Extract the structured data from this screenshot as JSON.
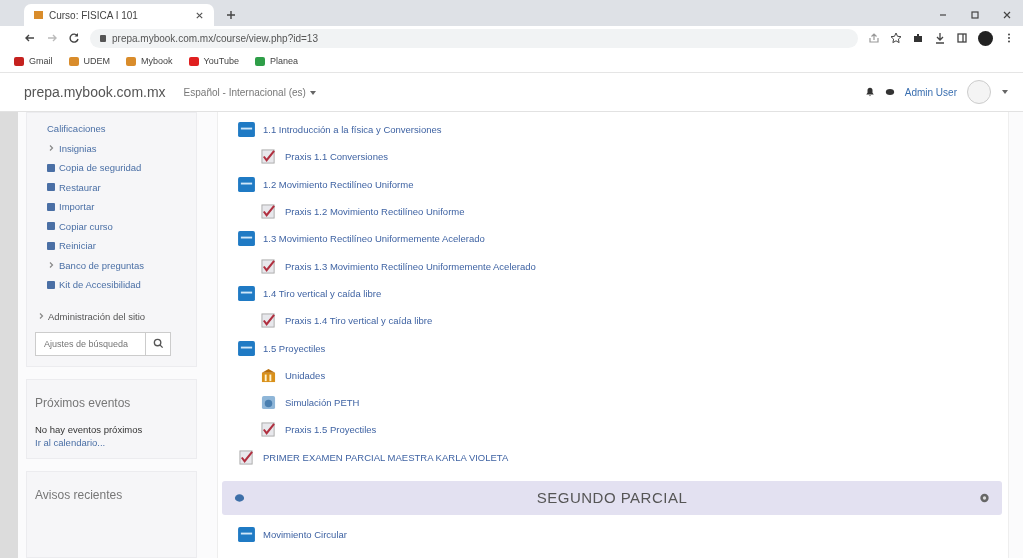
{
  "browser": {
    "tab_title": "Curso: FISICA I 101",
    "url": "prepa.mybook.com.mx/course/view.php?id=13",
    "bookmarks": [
      {
        "label": "Gmail",
        "color": "#c5221f"
      },
      {
        "label": "UDEM",
        "color": "#d98c2b"
      },
      {
        "label": "Mybook",
        "color": "#d98c2b"
      },
      {
        "label": "YouTube",
        "color": "#e02020"
      },
      {
        "label": "Planea",
        "color": "#2e9e48"
      }
    ]
  },
  "header": {
    "site": "prepa.mybook.com.mx",
    "language": "Español - Internacional (es)",
    "user": "Admin User"
  },
  "sidebar": {
    "items": [
      {
        "label": "Calificaciones",
        "kind": "plain"
      },
      {
        "label": "Insignias",
        "kind": "arrow"
      },
      {
        "label": "Copia de seguridad",
        "kind": "icon"
      },
      {
        "label": "Restaurar",
        "kind": "icon"
      },
      {
        "label": "Importar",
        "kind": "icon"
      },
      {
        "label": "Copiar curso",
        "kind": "icon"
      },
      {
        "label": "Reiniciar",
        "kind": "icon"
      },
      {
        "label": "Banco de preguntas",
        "kind": "arrow"
      },
      {
        "label": "Kit de Accesibilidad",
        "kind": "icon"
      }
    ],
    "admin": "Administración del sitio",
    "search_placeholder": "Ajustes de búsqueda",
    "events": {
      "title": "Próximos eventos",
      "text": "No hay eventos próximos",
      "link": "Ir al calendario..."
    },
    "news": {
      "title": "Avisos recientes"
    }
  },
  "content": {
    "items": [
      {
        "label": "1.1 Introducción a la física y Conversiones",
        "kind": "page",
        "children": [
          {
            "label": "Praxis 1.1 Conversiones",
            "kind": "quiz"
          }
        ]
      },
      {
        "label": "1.2 Movimiento Rectilíneo Uniforme",
        "kind": "page",
        "children": [
          {
            "label": "Praxis 1.2 Movimiento Rectilíneo Uniforme",
            "kind": "quiz"
          }
        ]
      },
      {
        "label": "1.3 Movimiento Rectilíneo Uniformemente Acelerado",
        "kind": "page",
        "children": [
          {
            "label": "Praxis 1.3 Movimiento Rectilíneo Uniformemente Acelerado",
            "kind": "quiz"
          }
        ]
      },
      {
        "label": "1.4 Tiro vertical y caída libre",
        "kind": "page",
        "children": [
          {
            "label": "Praxis 1.4 Tiro vertical y caída libre",
            "kind": "quiz"
          }
        ]
      },
      {
        "label": "1.5 Proyectiles",
        "kind": "page",
        "children": [
          {
            "label": "Unidades",
            "kind": "folder"
          },
          {
            "label": "Simulación PETH",
            "kind": "simulation"
          },
          {
            "label": "Praxis 1.5 Proyectiles",
            "kind": "quiz"
          }
        ]
      },
      {
        "label": "PRIMER EXAMEN PARCIAL MAESTRA KARLA VIOLETA",
        "kind": "quiz"
      }
    ],
    "section": {
      "title": "SEGUNDO PARCIAL"
    },
    "after": [
      {
        "label": "Movimiento Circular",
        "kind": "page"
      }
    ]
  }
}
